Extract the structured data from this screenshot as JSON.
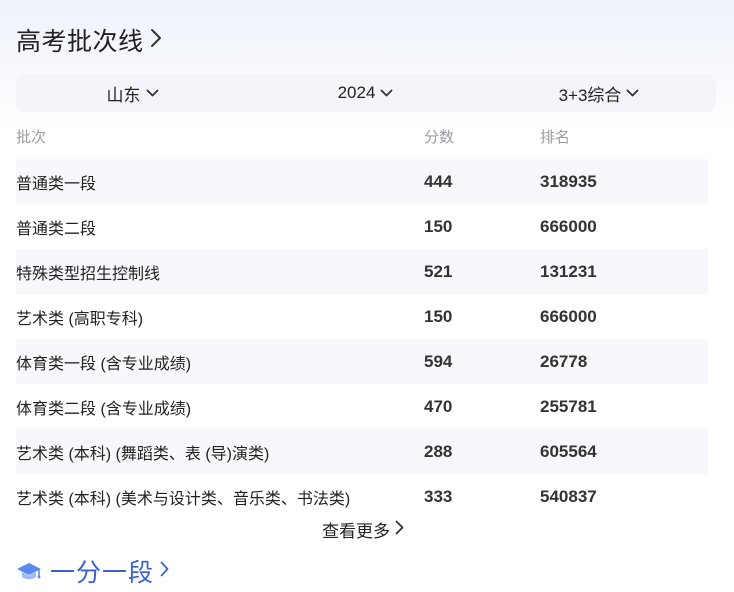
{
  "section": {
    "title": "高考批次线"
  },
  "filters": {
    "province": "山东",
    "year": "2024",
    "subject": "3+3综合"
  },
  "table": {
    "headers": {
      "name": "批次",
      "score": "分数",
      "rank": "排名"
    },
    "rows": [
      {
        "name": "普通类一段",
        "score": "444",
        "rank": "318935"
      },
      {
        "name": "普通类二段",
        "score": "150",
        "rank": "666000"
      },
      {
        "name": "特殊类型招生控制线",
        "score": "521",
        "rank": "131231"
      },
      {
        "name": "艺术类 (高职专科)",
        "score": "150",
        "rank": "666000"
      },
      {
        "name": "体育类一段 (含专业成绩)",
        "score": "594",
        "rank": "26778"
      },
      {
        "name": "体育类二段 (含专业成绩)",
        "score": "470",
        "rank": "255781"
      },
      {
        "name": "艺术类 (本科) (舞蹈类、表 (导)演类)",
        "score": "288",
        "rank": "605564"
      },
      {
        "name": "艺术类 (本科) (美术与设计类、音乐类、书法类)",
        "score": "333",
        "rank": "540837"
      }
    ]
  },
  "more_label": "查看更多",
  "next_section": {
    "title": "一分一段",
    "icon": "graduation-cap-icon",
    "color": "#3a63c9"
  }
}
